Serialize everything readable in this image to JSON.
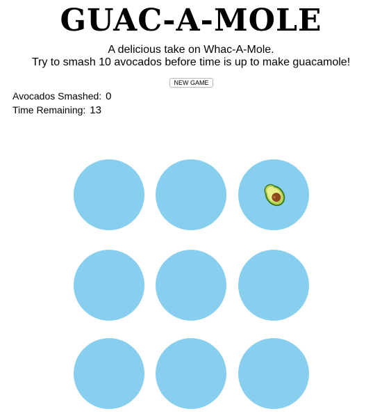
{
  "title": "GUAC-A-MOLE",
  "subtitle_line1": "A delicious take on Whac-A-Mole.",
  "subtitle_line2": "Try to smash 10 avocados before time is up to make guacamole!",
  "new_game_label": "NEW GAME",
  "stats": {
    "smashed_label": "Avocados Smashed:",
    "smashed_value": "0",
    "time_label": "Time Remaining:",
    "time_value": "13"
  },
  "board": {
    "hole_color": "#88cfef",
    "rows": 3,
    "cols": 3,
    "avocado_hole": 2,
    "avocado_icon": "avocado-icon"
  }
}
